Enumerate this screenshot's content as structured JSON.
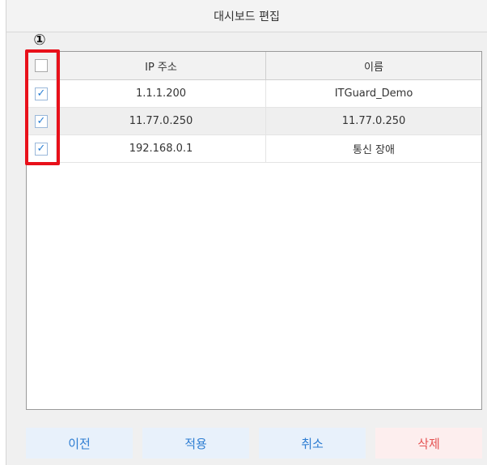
{
  "window": {
    "title": "대시보드 편집"
  },
  "annotation": {
    "marker": "①",
    "highlight_color": "#e8101a"
  },
  "table": {
    "headers": {
      "ip": "IP 주소",
      "name": "이름"
    },
    "header_checkbox_checked": false,
    "rows": [
      {
        "checked": true,
        "check_glyph": "✓",
        "ip": "1.1.1.200",
        "name": "ITGuard_Demo"
      },
      {
        "checked": true,
        "check_glyph": "✓",
        "ip": "11.77.0.250",
        "name": "11.77.0.250"
      },
      {
        "checked": true,
        "check_glyph": "✓",
        "ip": "192.168.0.1",
        "name": "통신 장애"
      }
    ]
  },
  "buttons": {
    "prev": "이전",
    "apply": "적용",
    "cancel": "취소",
    "delete": "삭제"
  },
  "colors": {
    "accent": "#2d7dd2",
    "danger": "#e55353"
  }
}
